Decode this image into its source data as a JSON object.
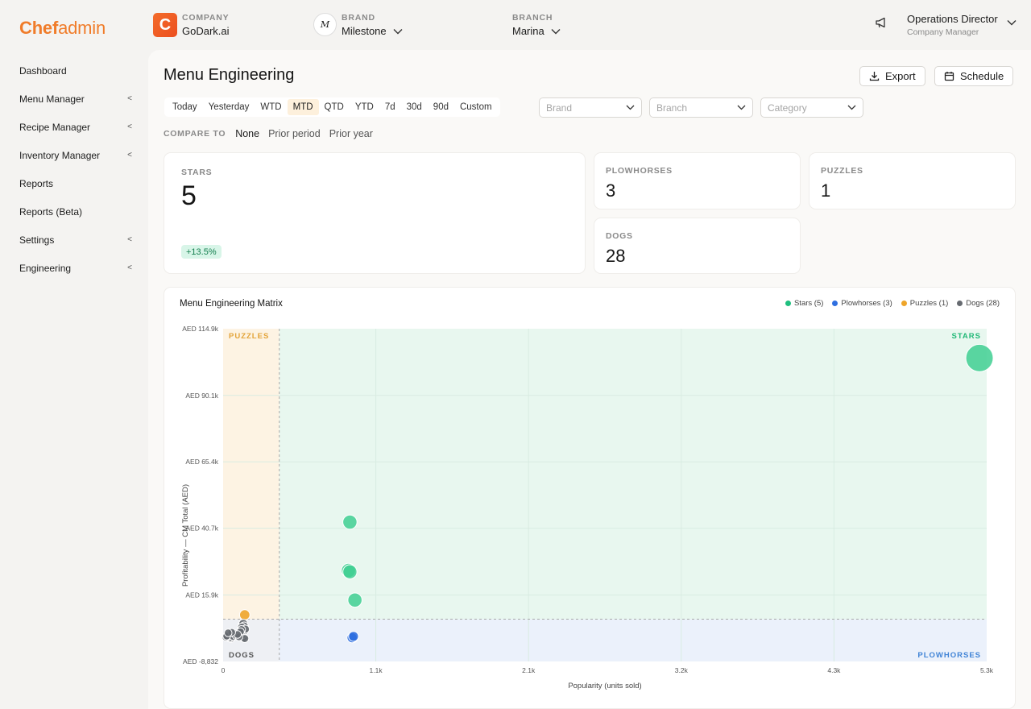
{
  "logo": {
    "part1": "Chef",
    "part2": "admin"
  },
  "sidebar": {
    "items": [
      {
        "label": "Dashboard",
        "chevron": false
      },
      {
        "label": "Menu Manager",
        "chevron": true
      },
      {
        "label": "Recipe Manager",
        "chevron": true
      },
      {
        "label": "Inventory Manager",
        "chevron": true
      },
      {
        "label": "Reports",
        "chevron": false
      },
      {
        "label": "Reports (Beta)",
        "chevron": false
      },
      {
        "label": "Settings",
        "chevron": true
      },
      {
        "label": "Engineering",
        "chevron": true
      }
    ],
    "chevron_glyph": "<"
  },
  "topbar": {
    "company": {
      "label": "COMPANY",
      "value": "GoDark.ai",
      "logo_letter": "C"
    },
    "brand": {
      "label": "BRAND",
      "value": "Milestone",
      "logo_letter": "M"
    },
    "branch": {
      "label": "BRANCH",
      "value": "Marina"
    },
    "user": {
      "name": "Operations Director",
      "role": "Company Manager"
    }
  },
  "header": {
    "title": "Menu Engineering",
    "export_label": "Export",
    "schedule_label": "Schedule"
  },
  "date_range": {
    "options": [
      "Today",
      "Yesterday",
      "WTD",
      "MTD",
      "QTD",
      "YTD",
      "7d",
      "30d",
      "90d",
      "Custom"
    ],
    "active": "MTD"
  },
  "filters": {
    "brand_placeholder": "Brand",
    "branch_placeholder": "Branch",
    "category_placeholder": "Category"
  },
  "compare": {
    "label": "COMPARE TO",
    "options": [
      "None",
      "Prior period",
      "Prior year"
    ],
    "active": "None"
  },
  "kpis": {
    "stars": {
      "label": "STARS",
      "value": "5",
      "delta": "+13.5%"
    },
    "plowhorses": {
      "label": "PLOWHORSES",
      "value": "3"
    },
    "puzzles": {
      "label": "PUZZLES",
      "value": "1"
    },
    "dogs": {
      "label": "DOGS",
      "value": "28"
    }
  },
  "chart_data": {
    "type": "scatter",
    "title": "Menu Engineering Matrix",
    "xlabel": "Popularity (units sold)",
    "ylabel": "Profitability — CM Total (AED)",
    "xlim": [
      0,
      5300
    ],
    "ylim": [
      -8832,
      114900
    ],
    "x_tick_labels": [
      "0",
      "1.1k",
      "2.1k",
      "3.2k",
      "4.3k",
      "5.3k"
    ],
    "x_tick_values": [
      0,
      1060,
      2120,
      3180,
      4240,
      5300
    ],
    "y_tick_labels": [
      "AED -8,832",
      "AED 15.9k",
      "AED 40.7k",
      "AED 65.4k",
      "AED 90.1k",
      "AED 114.9k"
    ],
    "y_tick_values": [
      -8832,
      15900,
      40700,
      65400,
      90100,
      114900
    ],
    "threshold_x": 390,
    "threshold_y": 6900,
    "quadrant_labels": {
      "puzzles": "PUZZLES",
      "stars": "STARS",
      "dogs": "DOGS",
      "plowhorses": "PLOWHORSES"
    },
    "legend": [
      {
        "name": "Stars (5)",
        "color": "#1fbf7f"
      },
      {
        "name": "Plowhorses (3)",
        "color": "#2f6fe0"
      },
      {
        "name": "Puzzles (1)",
        "color": "#eea52a"
      },
      {
        "name": "Dogs (28)",
        "color": "#666a70"
      }
    ],
    "series": [
      {
        "name": "Stars",
        "color": "#3fcf92",
        "points": [
          {
            "x": 5250,
            "y": 104000,
            "size": 5200
          },
          {
            "x": 880,
            "y": 43000,
            "size": 880
          },
          {
            "x": 870,
            "y": 25000,
            "size": 880
          },
          {
            "x": 880,
            "y": 24500,
            "size": 860
          },
          {
            "x": 915,
            "y": 14000,
            "size": 880
          }
        ]
      },
      {
        "name": "Plowhorses",
        "color": "#2f6fe0",
        "points": [
          {
            "x": 900,
            "y": 0,
            "size": 280
          },
          {
            "x": 895,
            "y": 0,
            "size": 270
          },
          {
            "x": 905,
            "y": 500,
            "size": 260
          }
        ]
      },
      {
        "name": "Puzzles",
        "color": "#eea52a",
        "points": [
          {
            "x": 150,
            "y": 8500,
            "size": 300
          }
        ]
      },
      {
        "name": "Dogs",
        "color": "#666a70",
        "points": [
          {
            "x": 135,
            "y": 4600,
            "size": 180
          },
          {
            "x": 140,
            "y": 5200,
            "size": 170
          },
          {
            "x": 145,
            "y": 4200,
            "size": 160
          },
          {
            "x": 130,
            "y": 3800,
            "size": 150
          },
          {
            "x": 60,
            "y": 1200,
            "size": 120
          },
          {
            "x": 50,
            "y": 1600,
            "size": 110
          },
          {
            "x": 40,
            "y": 800,
            "size": 100
          },
          {
            "x": 45,
            "y": 0,
            "size": 100
          },
          {
            "x": 55,
            "y": -200,
            "size": 110
          },
          {
            "x": 135,
            "y": 400,
            "size": 130
          },
          {
            "x": 140,
            "y": 0,
            "size": 120
          },
          {
            "x": 130,
            "y": 1000,
            "size": 120
          },
          {
            "x": 125,
            "y": 1800,
            "size": 110
          },
          {
            "x": 145,
            "y": 2500,
            "size": 120
          },
          {
            "x": 150,
            "y": -300,
            "size": 100
          },
          {
            "x": 30,
            "y": 300,
            "size": 90
          },
          {
            "x": 20,
            "y": 200,
            "size": 80
          },
          {
            "x": 25,
            "y": 600,
            "size": 80
          },
          {
            "x": 70,
            "y": 500,
            "size": 90
          },
          {
            "x": 80,
            "y": 1500,
            "size": 90
          },
          {
            "x": 90,
            "y": 800,
            "size": 80
          },
          {
            "x": 110,
            "y": 300,
            "size": 80
          },
          {
            "x": 100,
            "y": 1200,
            "size": 80
          },
          {
            "x": 120,
            "y": 2200,
            "size": 90
          },
          {
            "x": 60,
            "y": 2000,
            "size": 80
          },
          {
            "x": 35,
            "y": 1800,
            "size": 80
          },
          {
            "x": 155,
            "y": 3200,
            "size": 100
          },
          {
            "x": 128,
            "y": 3000,
            "size": 100
          }
        ]
      }
    ]
  }
}
